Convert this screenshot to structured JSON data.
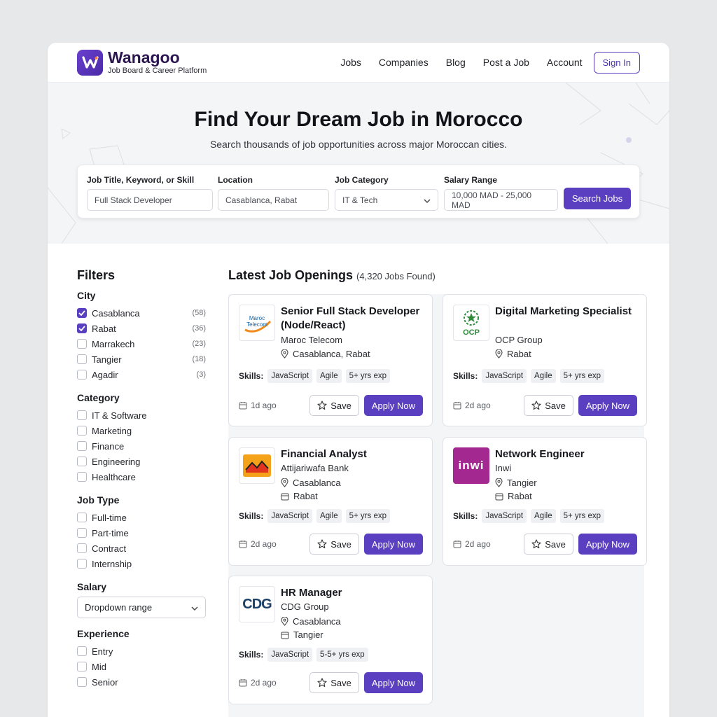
{
  "header": {
    "brand_name": "Wanagoo",
    "brand_tagline": "Job Board & Career Platform",
    "nav": [
      "Jobs",
      "Companies",
      "Blog",
      "Post a Job",
      "Account"
    ],
    "sign_in_label": "Sign In"
  },
  "hero": {
    "title": "Find Your Dream Job in Morocco",
    "subtitle": "Search thousands of job opportunities across major Moroccan cities."
  },
  "search": {
    "keyword_label": "Job Title, Keyword, or Skill",
    "keyword_value": "Full Stack Developer",
    "location_label": "Location",
    "location_value": "Casablanca, Rabat",
    "category_label": "Job Category",
    "category_value": "IT & Tech",
    "salary_label": "Salary Range",
    "salary_value": "10,000 MAD - 25,000 MAD",
    "button_label": "Search Jobs"
  },
  "filters": {
    "title": "Filters",
    "city": {
      "title": "City",
      "items": [
        {
          "label": "Casablanca",
          "count": "(58)",
          "checked": true
        },
        {
          "label": "Rabat",
          "count": "(36)",
          "checked": true
        },
        {
          "label": "Marrakech",
          "count": "(23)",
          "checked": false
        },
        {
          "label": "Tangier",
          "count": "(18)",
          "checked": false
        },
        {
          "label": "Agadir",
          "count": "(3)",
          "checked": false
        }
      ]
    },
    "category": {
      "title": "Category",
      "items": [
        "IT & Software",
        "Marketing",
        "Finance",
        "Engineering",
        "Healthcare"
      ]
    },
    "job_type": {
      "title": "Job Type",
      "items": [
        "Full-time",
        "Part-time",
        "Contract",
        "Internship"
      ]
    },
    "salary": {
      "title": "Salary",
      "dropdown_value": "Dropdown range"
    },
    "experience": {
      "title": "Experience",
      "items": [
        "Entry",
        "Mid",
        "Senior"
      ]
    }
  },
  "listing": {
    "title": "Latest Job Openings",
    "found": "(4,320 Jobs Found)",
    "skills_label": "Skills:",
    "save_label": "Save",
    "apply_label": "Apply Now",
    "jobs": [
      {
        "title": "Senior Full Stack Developer (Node/React)",
        "company": "Maroc Telecom",
        "logo_text": "Maroc Telecom",
        "location": "Casablanca, Rabat",
        "location2": "",
        "skills": [
          "JavaScript",
          "Agile",
          "5+ yrs exp"
        ],
        "age": "1d ago"
      },
      {
        "title": "Digital Marketing Specialist",
        "company": "OCP Group",
        "logo_text": "OCP",
        "location": "Rabat",
        "location2": "",
        "skills": [
          "JavaScript",
          "Agile",
          "5+ yrs exp"
        ],
        "age": "2d ago"
      },
      {
        "title": "Financial Analyst",
        "company": "Attijariwafa Bank",
        "logo_text": "",
        "location": "Casablanca",
        "location2": "Rabat",
        "skills": [
          "JavaScript",
          "Agile",
          "5+ yrs exp"
        ],
        "age": "2d ago"
      },
      {
        "title": "Network Engineer",
        "company": "Inwi",
        "logo_text": "inwi",
        "location": "Tangier",
        "location2": "Rabat",
        "skills": [
          "JavaScript",
          "Agile",
          "5+ yrs exp"
        ],
        "age": "2d ago"
      },
      {
        "title": "HR Manager",
        "company": "CDG Group",
        "logo_text": "CDG",
        "location": "Casablanca",
        "location2": "Tangier",
        "skills": [
          "JavaScript",
          "5-5+ yrs exp"
        ],
        "age": "2d ago"
      }
    ]
  },
  "colors": {
    "accent": "#5a3fc0",
    "brand_dark": "#2b1650",
    "inwi": "#a3288f",
    "ocp": "#2f8a3a",
    "maroc_telecom": "#0a5fa8"
  },
  "icons": [
    "wanagoo-logo-icon",
    "check-icon",
    "chevron-down-icon",
    "location-pin-icon",
    "building-icon",
    "calendar-icon",
    "star-icon"
  ]
}
